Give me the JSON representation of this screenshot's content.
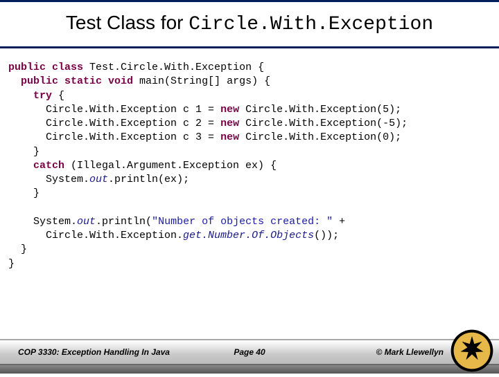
{
  "title": {
    "plain": "Test Class for ",
    "mono": "Circle.With.Exception"
  },
  "code": {
    "l1a": "public",
    "l1b": " class",
    "l1c": " Test.Circle.With.Exception {",
    "l2a": "  public",
    "l2b": " static",
    "l2c": " void",
    "l2d": " main(String[] args) {",
    "l3a": "    try",
    "l3b": " {",
    "l4a": "      Circle.With.Exception c 1 = ",
    "l4b": "new",
    "l4c": " Circle.With.Exception(5);",
    "l5a": "      Circle.With.Exception c 2 = ",
    "l5b": "new",
    "l5c": " Circle.With.Exception(-5);",
    "l6a": "      Circle.With.Exception c 3 = ",
    "l6b": "new",
    "l6c": " Circle.With.Exception(0);",
    "l7": "    }",
    "l8a": "    catch",
    "l8b": " (Illegal.Argument.Exception ex) {",
    "l9a": "      System.",
    "l9b": "out",
    "l9c": ".println(ex);",
    "l10": "    }",
    "blank": "",
    "l11a": "    System.",
    "l11b": "out",
    "l11c": ".println(",
    "l11d": "\"Number of objects created: \"",
    "l11e": " +",
    "l12a": "      Circle.With.Exception.",
    "l12b": "get.Number.Of.Objects",
    "l12c": "());",
    "l13": "  }",
    "l14": "}"
  },
  "footer": {
    "left": "COP 3330: Exception Handling In Java",
    "center": "Page 40",
    "right": "© Mark Llewellyn"
  }
}
